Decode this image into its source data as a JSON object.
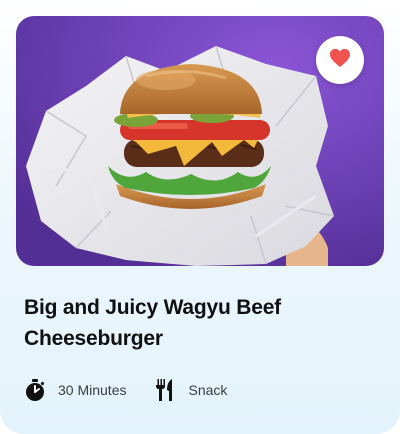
{
  "recipe": {
    "title": "Big and Juicy Wagyu Beef Cheeseburger",
    "duration": "30 Minutes",
    "category": "Snack",
    "favorite": true
  },
  "icons": {
    "favorite": "heart-icon",
    "duration": "stopwatch-icon",
    "category": "fork-knife-icon"
  },
  "colors": {
    "heart": "#f0524e",
    "photo_background": "#6a3fb2",
    "card_background": "#e8f5fb",
    "title": "#111111"
  }
}
